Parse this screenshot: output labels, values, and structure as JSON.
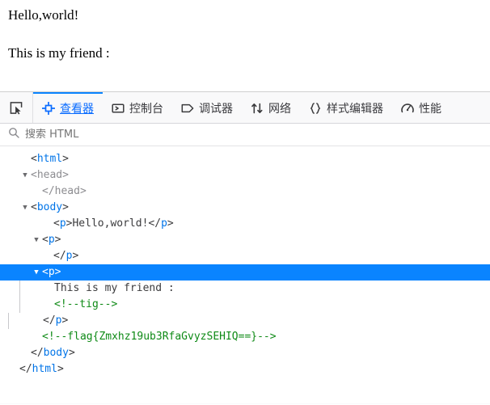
{
  "page": {
    "paragraphs": [
      "Hello,world!",
      "This is my friend :"
    ]
  },
  "devtools": {
    "picker": {
      "name": "element-picker",
      "icon": "cursor-picker-icon"
    },
    "tabs": [
      {
        "label": "查看器",
        "icon": "inspector-target-icon",
        "active": true
      },
      {
        "label": "控制台",
        "icon": "console-prompt-icon",
        "active": false
      },
      {
        "label": "调试器",
        "icon": "debugger-tag-icon",
        "active": false
      },
      {
        "label": "网络",
        "icon": "network-arrows-icon",
        "active": false
      },
      {
        "label": "样式编辑器",
        "icon": "style-braces-icon",
        "active": false
      },
      {
        "label": "性能",
        "icon": "performance-gauge-icon",
        "active": false
      }
    ],
    "search": {
      "placeholder": "搜索 HTML",
      "value": "",
      "icon": "search-icon"
    },
    "colors": {
      "accent": "#0a84ff",
      "tag": "#0074e8",
      "comment": "#0e8a16",
      "punct": "#3b3b3d",
      "selected_bg": "#0a84ff",
      "toolbar_bg": "#f9f9fa"
    },
    "tree": [
      {
        "id": "r0",
        "indent": 1,
        "twisty": "",
        "selected": false,
        "muted": false,
        "parts": [
          {
            "t": "punct",
            "v": "<"
          },
          {
            "t": "tag",
            "v": "html"
          },
          {
            "t": "punct",
            "v": ">"
          }
        ]
      },
      {
        "id": "r1",
        "indent": 1,
        "twisty": "▼",
        "selected": false,
        "muted": true,
        "parts": [
          {
            "t": "punct",
            "v": "<"
          },
          {
            "t": "tag",
            "v": "head"
          },
          {
            "t": "punct",
            "v": ">"
          }
        ]
      },
      {
        "id": "r2",
        "indent": 2,
        "twisty": "",
        "selected": false,
        "muted": true,
        "parts": [
          {
            "t": "punct",
            "v": "</"
          },
          {
            "t": "tag",
            "v": "head"
          },
          {
            "t": "punct",
            "v": ">"
          }
        ]
      },
      {
        "id": "r3",
        "indent": 1,
        "twisty": "▼",
        "selected": false,
        "muted": false,
        "parts": [
          {
            "t": "punct",
            "v": "<"
          },
          {
            "t": "tag",
            "v": "body"
          },
          {
            "t": "punct",
            "v": ">"
          }
        ]
      },
      {
        "id": "r4",
        "indent": 3,
        "twisty": "",
        "selected": false,
        "muted": false,
        "parts": [
          {
            "t": "punct",
            "v": "<"
          },
          {
            "t": "tag",
            "v": "p"
          },
          {
            "t": "punct",
            "v": ">"
          },
          {
            "t": "text",
            "v": "Hello,world!"
          },
          {
            "t": "punct",
            "v": "</"
          },
          {
            "t": "tag",
            "v": "p"
          },
          {
            "t": "punct",
            "v": ">"
          }
        ]
      },
      {
        "id": "r5",
        "indent": 2,
        "twisty": "▼",
        "selected": false,
        "muted": false,
        "parts": [
          {
            "t": "punct",
            "v": "<"
          },
          {
            "t": "tag",
            "v": "p"
          },
          {
            "t": "punct",
            "v": ">"
          }
        ]
      },
      {
        "id": "r6",
        "indent": 3,
        "twisty": "",
        "selected": false,
        "muted": false,
        "parts": [
          {
            "t": "punct",
            "v": "</"
          },
          {
            "t": "tag",
            "v": "p"
          },
          {
            "t": "punct",
            "v": ">"
          }
        ]
      },
      {
        "id": "r7",
        "indent": 2,
        "twisty": "▼",
        "selected": true,
        "muted": false,
        "parts": [
          {
            "t": "punct",
            "v": "<"
          },
          {
            "t": "tag",
            "v": "p"
          },
          {
            "t": "punct",
            "v": ">"
          }
        ]
      },
      {
        "id": "r8",
        "indent": 3,
        "twisty": "",
        "selected": false,
        "muted": false,
        "guide": true,
        "parts": [
          {
            "t": "text",
            "v": "This is my friend :"
          }
        ]
      },
      {
        "id": "r9",
        "indent": 3,
        "twisty": "",
        "selected": false,
        "muted": false,
        "guide": true,
        "parts": [
          {
            "t": "comment",
            "v": "<!--tig-->"
          }
        ]
      },
      {
        "id": "r10",
        "indent": 2,
        "twisty": "",
        "selected": false,
        "muted": false,
        "guide": true,
        "parts": [
          {
            "t": "punct",
            "v": "</"
          },
          {
            "t": "tag",
            "v": "p"
          },
          {
            "t": "punct",
            "v": ">"
          }
        ]
      },
      {
        "id": "r11",
        "indent": 2,
        "twisty": "",
        "selected": false,
        "muted": false,
        "parts": [
          {
            "t": "comment",
            "v": "<!--flag{Zmxhz19ub3RfaGvyzSEHIQ==}-->"
          }
        ]
      },
      {
        "id": "r12",
        "indent": 1,
        "twisty": "",
        "selected": false,
        "muted": false,
        "parts": [
          {
            "t": "punct",
            "v": "</"
          },
          {
            "t": "tag",
            "v": "body"
          },
          {
            "t": "punct",
            "v": ">"
          }
        ]
      },
      {
        "id": "r13",
        "indent": 0,
        "twisty": "",
        "selected": false,
        "muted": false,
        "parts": [
          {
            "t": "punct",
            "v": "</"
          },
          {
            "t": "tag",
            "v": "html"
          },
          {
            "t": "punct",
            "v": ">"
          }
        ]
      }
    ]
  }
}
